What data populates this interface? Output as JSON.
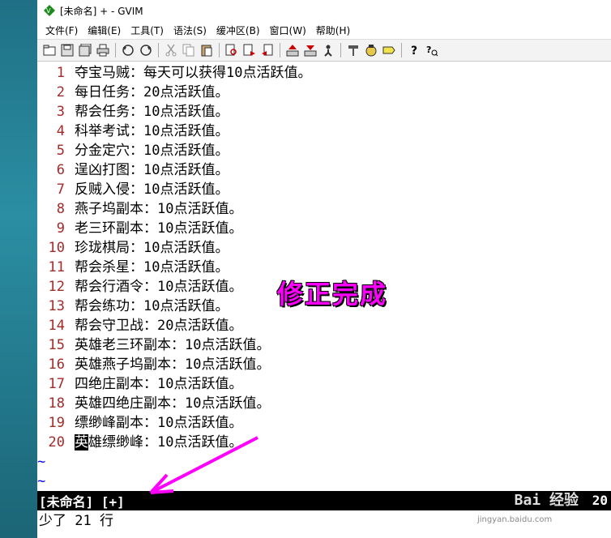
{
  "window": {
    "title": "[未命名] + - GVIM"
  },
  "menu": [
    "文件(F)",
    "编辑(E)",
    "工具(T)",
    "语法(S)",
    "缓冲区(B)",
    "窗口(W)",
    "帮助(H)"
  ],
  "toolbar": [
    "open-icon",
    "save-icon",
    "save-all-icon",
    "print-icon",
    "sep",
    "undo-icon",
    "redo-icon",
    "sep",
    "cut-icon",
    "copy-icon",
    "paste-icon",
    "sep",
    "find-replace-icon",
    "find-next-icon",
    "find-prev-icon",
    "sep",
    "load-session-icon",
    "save-session-icon",
    "run-script-icon",
    "sep",
    "make-icon",
    "shell-icon",
    "tag-icon",
    "sep",
    "help-icon",
    "find-help-icon"
  ],
  "editor": {
    "lines": [
      {
        "num": "1",
        "text": "夺宝马贼：每天可以获得10点活跃值。"
      },
      {
        "num": "2",
        "text": "每日任务：20点活跃值。"
      },
      {
        "num": "3",
        "text": "帮会任务：10点活跃值。"
      },
      {
        "num": "4",
        "text": "科举考试：10点活跃值。"
      },
      {
        "num": "5",
        "text": "分金定穴：10点活跃值。"
      },
      {
        "num": "6",
        "text": "逞凶打图：10点活跃值。"
      },
      {
        "num": "7",
        "text": "反贼入侵：10点活跃值。"
      },
      {
        "num": "8",
        "text": "燕子坞副本：10点活跃值。"
      },
      {
        "num": "9",
        "text": "老三环副本：10点活跃值。"
      },
      {
        "num": "10",
        "text": "珍珑棋局：10点活跃值。"
      },
      {
        "num": "11",
        "text": "帮会杀星：10点活跃值。"
      },
      {
        "num": "12",
        "text": "帮会行酒令：10点活跃值。"
      },
      {
        "num": "13",
        "text": "帮会练功：10点活跃值。"
      },
      {
        "num": "14",
        "text": "帮会守卫战：20点活跃值。"
      },
      {
        "num": "15",
        "text": "英雄老三环副本：10点活跃值。"
      },
      {
        "num": "16",
        "text": "英雄燕子坞副本：10点活跃值。"
      },
      {
        "num": "17",
        "text": "四绝庄副本：10点活跃值。"
      },
      {
        "num": "18",
        "text": "英雄四绝庄副本：10点活跃值。"
      },
      {
        "num": "19",
        "text": "缥缈峰副本：10点活跃值。"
      },
      {
        "num": "20",
        "cursor": "英",
        "text": "雄缥缈峰：10点活跃值。"
      }
    ],
    "tildes": [
      "~",
      "~"
    ]
  },
  "annotation": "修正完成",
  "status": {
    "name": "[未命名]  [+]",
    "position": "20"
  },
  "watermark": {
    "text": "Bai 经验",
    "sub": "jingyan.baidu.com"
  },
  "cmdline": "少了 21 行",
  "colors": {
    "annotation": "#ff00ff",
    "line_number": "#a52a2a",
    "tilde": "#0000ff"
  }
}
